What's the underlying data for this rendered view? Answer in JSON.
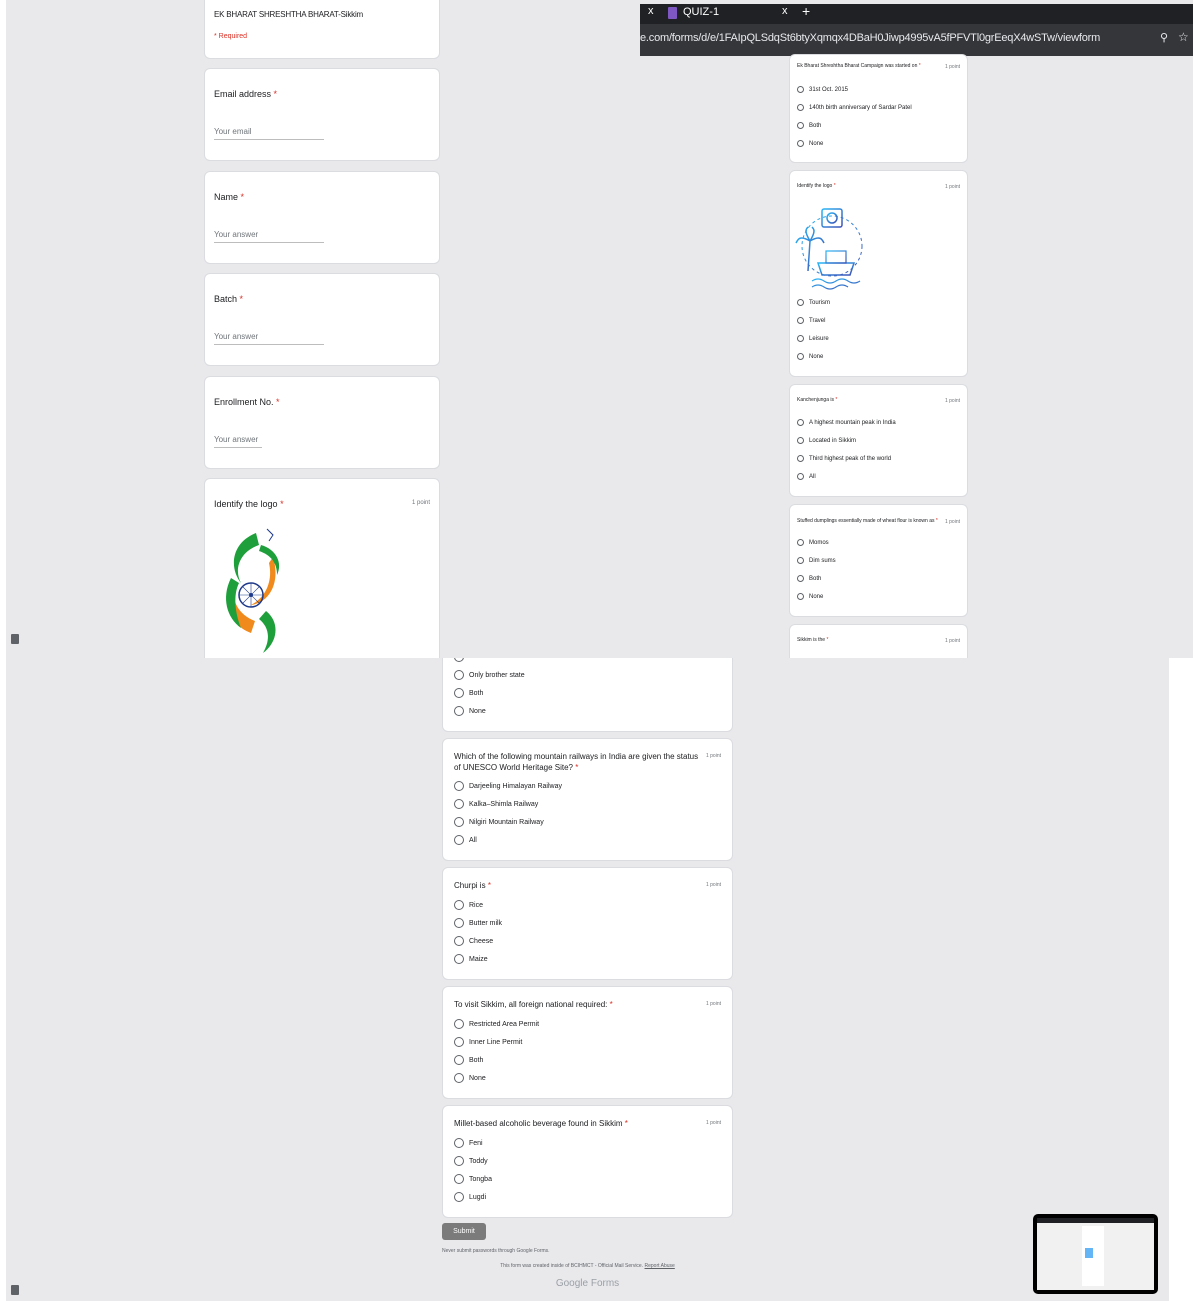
{
  "panel1": {
    "header": {
      "title": "EK BHARAT SHRESHTHA BHARAT-Sikkim",
      "required_note": "* Required"
    },
    "fields": [
      {
        "label": "Email address",
        "placeholder": "Your email"
      },
      {
        "label": "Name",
        "placeholder": "Your answer"
      },
      {
        "label": "Batch",
        "placeholder": "Your answer"
      },
      {
        "label": "Enrollment No.",
        "placeholder": "Your answer"
      }
    ],
    "logo_question": {
      "title": "Identify the logo",
      "points": "1 point"
    }
  },
  "panel2": {
    "tabs": {
      "close_glyph": "x",
      "active_tab": "QUIZ-1",
      "new_tab_glyph": "+"
    },
    "url": "e.com/forms/d/e/1FAIpQLSdqSt6btyXqmqx4DBaH0Jiwp4995vA5fPFVTl0grEeqX4wSTw/viewform",
    "questions": [
      {
        "title": "Ek Bharat Shreshtha Bharat Campaign was started on",
        "points": "1 point",
        "options": [
          "31st Oct. 2015",
          "140th birth anniversary of Sardar Patel",
          "Both",
          "None"
        ]
      },
      {
        "title": "Identify the logo",
        "points": "1 point",
        "options": [
          "Tourism",
          "Travel",
          "Leisure",
          "None"
        ]
      },
      {
        "title": "Kanchenjunga is",
        "points": "1 point",
        "options": [
          "A highest mountain peak in India",
          "Located in Sikkim",
          "Third highest peak of the world",
          "All"
        ]
      },
      {
        "title": "Stuffed dumplings essentially made of wheat flour is known as",
        "points": "1 point",
        "options": [
          "Momos",
          "Dim sums",
          "Both",
          "None"
        ]
      },
      {
        "title": "Sikkim is the",
        "points": "1 point"
      }
    ]
  },
  "panel3": {
    "partial_options": [
      "Only brother state",
      "Both",
      "None"
    ],
    "questions": [
      {
        "title": "Which of the following mountain railways in India are given the status of UNESCO World Heritage Site?",
        "points": "1 point",
        "options": [
          "Darjeeling Himalayan Railway",
          "Kalka–Shimla Railway",
          "Nilgiri Mountain Railway",
          "All"
        ]
      },
      {
        "title": "Churpi is",
        "points": "1 point",
        "options": [
          "Rice",
          "Butter milk",
          "Cheese",
          "Maize"
        ]
      },
      {
        "title": "To visit Sikkim, all foreign national required:",
        "points": "1 point",
        "options": [
          "Restricted Area Permit",
          "Inner Line Permit",
          "Both",
          "None"
        ]
      },
      {
        "title": "Millet-based alcoholic beverage found in Sikkim",
        "points": "1 point",
        "options": [
          "Feni",
          "Toddy",
          "Tongba",
          "Lugdi"
        ]
      }
    ],
    "submit_label": "Submit",
    "footer": {
      "warning": "Never submit passwords through Google Forms.",
      "created_by": "This form was created inside of BCIHMCT - Official Mail Service.",
      "report_link": "Report Abuse",
      "brand_google": "Google",
      "brand_forms": "Forms"
    }
  },
  "asterisk": "*",
  "colors": {
    "required": "#d93025",
    "submit": "#7b7b7b",
    "chrome_dark": "#202124",
    "chrome_url": "#35363a",
    "panel_bg": "#e9e9ec"
  }
}
